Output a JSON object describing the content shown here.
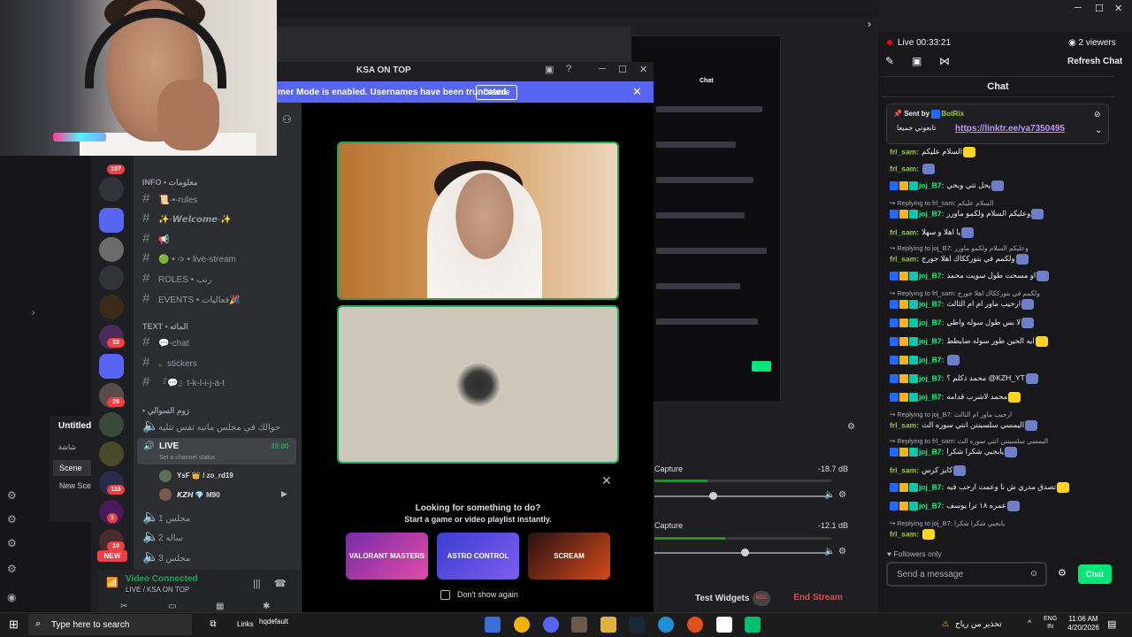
{
  "discord": {
    "window_title": "KSA ON TOP",
    "streamer_mode": "mer Mode is enabled. Usernames have been truncated.",
    "disable_label": "Disable",
    "server_badges": [
      "107",
      "33",
      "29",
      "119",
      "1",
      "10",
      "NEW"
    ],
    "categories": {
      "info": "INFO • معلومات",
      "text": "TEXT • الماته",
      "voice": "• زوم السوالي"
    },
    "channels": [
      "📜-•-rules",
      "✨-𝙒𝙚𝙡𝙘𝙤𝙢𝙚-✨",
      "📢",
      "🟢 • ➩ • live-stream",
      "ROLES • رتب",
      "EVENTS • فعاليات🎉",
      "💬-chat",
      "。stickers",
      "『💬』t-k-l-i-j-a-t",
      "حوالك في مجلس ماتيه تفس تتليه"
    ],
    "live_channel": {
      "label": "LIVE",
      "time": "39:00",
      "status_placeholder": "Set a channel status",
      "users": [
        "YsF 👑 / zo_rd19",
        "𝙆𝙕𝙃 💎 M90"
      ]
    },
    "voice_channels": [
      "مجلس 1",
      "ساله 2",
      "مجلس 3"
    ],
    "voice_connected": "Video Connected",
    "voice_connected_sub": "LIVE / KSA ON TOP",
    "suggest_title": "Looking for something to do?",
    "suggest_sub": "Start a game or video playlist instantly.",
    "games": [
      "VALORANT MASTERS",
      "ASTRO CONTROL",
      "SCREAM"
    ],
    "dont_show": "Don't show again"
  },
  "obs": {
    "scene_title": "Untitled",
    "scene_tab": "شاشة",
    "scene_items": [
      "Scene",
      "New Sce"
    ],
    "mixer": [
      {
        "label": "Capture",
        "db": "-18.7 dB",
        "level": 0.3
      },
      {
        "label": "Capture",
        "db": "-12.1 dB",
        "level": 0.4
      }
    ],
    "test_widgets": "Test Widgets",
    "rec": "REC",
    "end_stream": "End Stream"
  },
  "stream_manager": {
    "live_label": "Live 00:33:21",
    "viewers": "2 viewers",
    "refresh_chat": "Refresh Chat",
    "chat_title": "Chat",
    "pinned_sent_by": "Sent by",
    "pinned_bot": "BotRix",
    "pinned_ar": "تابعوني جميعا",
    "pinned_link": "https://linktr.ee/ya7350495",
    "followers_only": "Followers only",
    "input_placeholder": "Send a message",
    "chat_button": "Chat",
    "messages": [
      {
        "type": "msg",
        "user": "frl_sam:",
        "text": "السلام عليكم",
        "cls": "frl"
      },
      {
        "type": "msg",
        "user": "frl_sam:",
        "text": "",
        "cls": "frl"
      },
      {
        "type": "msg",
        "user": "joj_B7:",
        "text": "يحل تتي وبجي",
        "cls": "joj"
      },
      {
        "type": "reply",
        "text": "Replying to frl_sam: السلام عليكم"
      },
      {
        "type": "msg",
        "user": "joj_B7:",
        "text": "وعليكم السلام ولكمو ماورر",
        "cls": "joj"
      },
      {
        "type": "msg",
        "user": "frl_sam:",
        "text": "يا اهلا و سهلا",
        "cls": "frl"
      },
      {
        "type": "reply",
        "text": "Replying to joj_B7: وعليكم السلام ولكمو ماورر"
      },
      {
        "type": "msg",
        "user": "frl_sam:",
        "text": "ولكمم في بتورككاك اهلا جورج",
        "cls": "frl"
      },
      {
        "type": "msg",
        "user": "joj_B7:",
        "text": "او مسحت طول سويت محمد",
        "cls": "joj"
      },
      {
        "type": "reply",
        "text": "Replying to frl_sam: ولكمم في بتورككاك اهلا جورج"
      },
      {
        "type": "msg",
        "user": "joj_B7:",
        "text": "ارحيب ماور ام ام الثالث",
        "cls": "joj"
      },
      {
        "type": "msg",
        "user": "joj_B7:",
        "text": "لا بس طول سوله واطي",
        "cls": "joj"
      },
      {
        "type": "msg",
        "user": "joj_B7:",
        "text": "ايه الحين طور سوله ضايطط",
        "cls": "joj"
      },
      {
        "type": "msg",
        "user": "joj_B7:",
        "text": "",
        "cls": "joj"
      },
      {
        "type": "msg",
        "user": "joj_B7:",
        "text": "محمد ذكلم ؟ @KZH_YT",
        "cls": "joj"
      },
      {
        "type": "msg",
        "user": "joj_B7:",
        "text": "محمد لاشرب قدامه",
        "cls": "joj"
      },
      {
        "type": "reply",
        "text": "Replying to joj_B7: ارحيب ماور ام الثالث"
      },
      {
        "type": "msg",
        "user": "frl_sam:",
        "text": "اليمسي سلسينتن انتي سوره الث",
        "cls": "frl"
      },
      {
        "type": "reply",
        "text": "Replying to frl_sam: اليمسي سلسينتن انتي سوره الث"
      },
      {
        "type": "msg",
        "user": "joj_B7:",
        "text": "يابجبي شكرا شكرا",
        "cls": "joj"
      },
      {
        "type": "msg",
        "user": "frl_sam:",
        "text": "كايز كرس",
        "cls": "frl"
      },
      {
        "type": "msg",
        "user": "joj_B7:",
        "text": "تصدق مدري ش نا وعمت ارحب فيه",
        "cls": "joj"
      },
      {
        "type": "msg",
        "user": "joj_B7:",
        "text": "عمره ١٨ ترا يوسف",
        "cls": "joj"
      },
      {
        "type": "reply",
        "text": "Replying to joj_B7: يابجبي شكرا شكرا"
      },
      {
        "type": "msg",
        "user": "frl_sam:",
        "text": "",
        "cls": "frl"
      }
    ]
  },
  "taskbar": {
    "search_placeholder": "Type here to search",
    "links": "Links",
    "hqdefault": "hqdefault",
    "weather": "تحذير من رياح",
    "lang": "ENG",
    "lang2": "IN",
    "time": "11:06 AM",
    "date": "4/20/2026"
  },
  "colors": {
    "discord_blurple": "#5865f2",
    "discord_green": "#23a55a",
    "twitch_bg": "#18181b",
    "chat_button": "#00e676",
    "end_stream": "#e5484d"
  }
}
